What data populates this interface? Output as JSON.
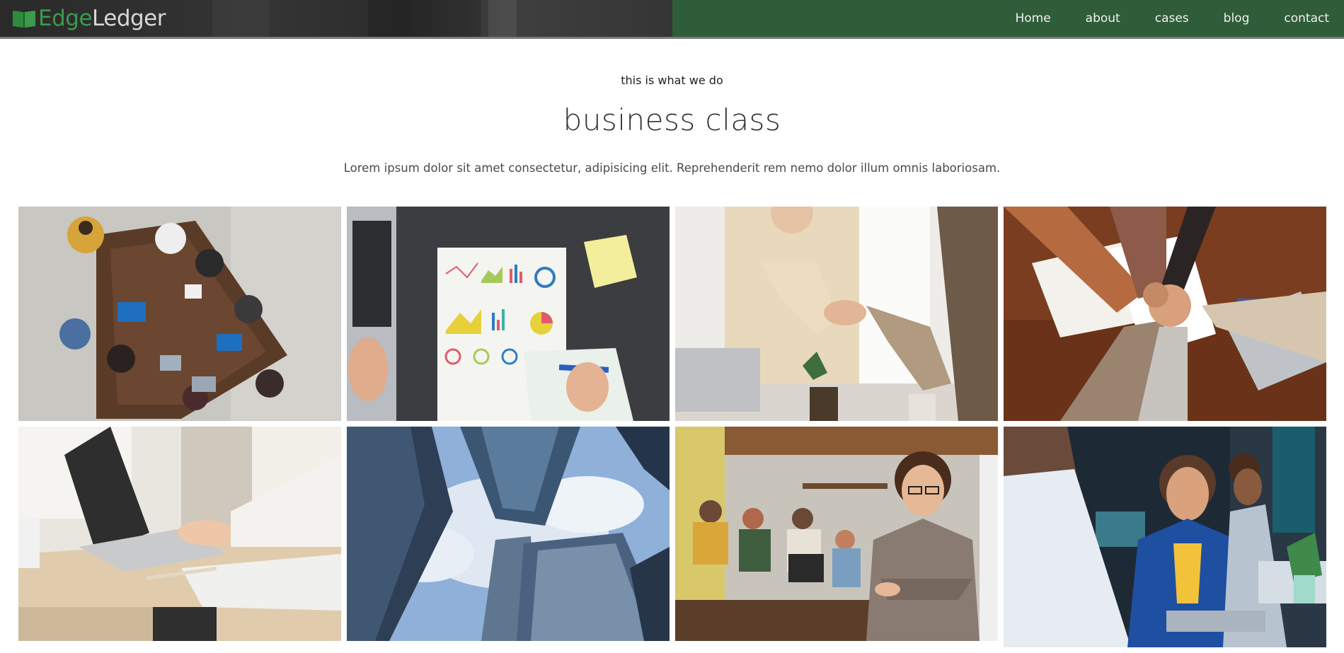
{
  "brand": {
    "name_part1": "Edge",
    "name_part2": "Ledger",
    "icon": "book-icon"
  },
  "nav": {
    "items": [
      {
        "label": "Home"
      },
      {
        "label": "about"
      },
      {
        "label": "cases"
      },
      {
        "label": "blog"
      },
      {
        "label": "contact"
      }
    ]
  },
  "section": {
    "eyebrow": "this is what we do",
    "title": "business class",
    "lead": "Lorem ipsum dolor sit amet consectetur, adipisicing elit. Reprehenderit rem nemo dolor illum omnis laboriosam."
  },
  "gallery": {
    "images": [
      {
        "name": "meeting-table-photo"
      },
      {
        "name": "charts-notebook-photo"
      },
      {
        "name": "handshake-photo"
      },
      {
        "name": "team-hands-photo"
      },
      {
        "name": "laptop-typing-photo"
      },
      {
        "name": "skyscrapers-photo"
      },
      {
        "name": "office-woman-photo"
      },
      {
        "name": "coworkers-smiling-photo"
      }
    ]
  },
  "colors": {
    "brand_green": "#2f5d3a",
    "logo_green": "#3c9a4c",
    "header_dark": "#2c2c2c"
  }
}
